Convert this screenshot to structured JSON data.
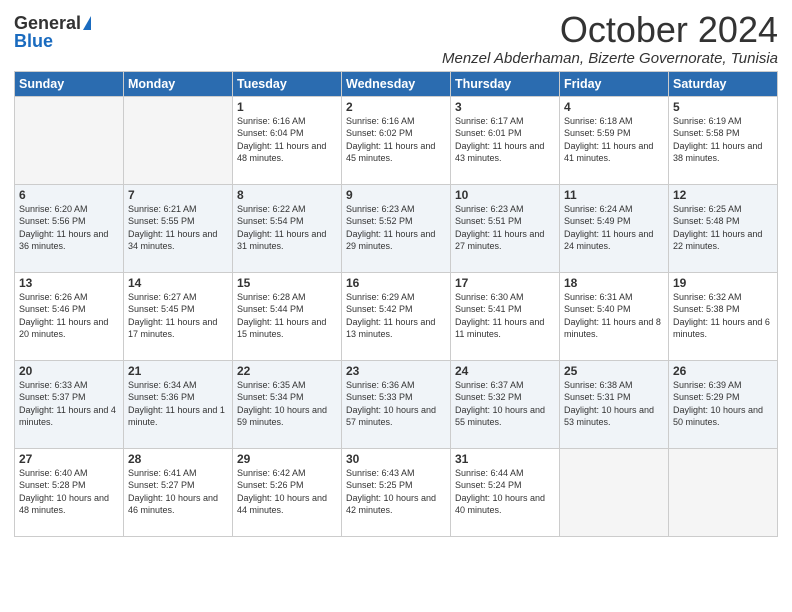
{
  "logo": {
    "general": "General",
    "blue": "Blue"
  },
  "title": "October 2024",
  "subtitle": "Menzel Abderhaman, Bizerte Governorate, Tunisia",
  "days_of_week": [
    "Sunday",
    "Monday",
    "Tuesday",
    "Wednesday",
    "Thursday",
    "Friday",
    "Saturday"
  ],
  "weeks": [
    [
      {
        "day": "",
        "sunrise": "",
        "sunset": "",
        "daylight": "",
        "empty": true
      },
      {
        "day": "",
        "sunrise": "",
        "sunset": "",
        "daylight": "",
        "empty": true
      },
      {
        "day": "1",
        "sunrise": "Sunrise: 6:16 AM",
        "sunset": "Sunset: 6:04 PM",
        "daylight": "Daylight: 11 hours and 48 minutes."
      },
      {
        "day": "2",
        "sunrise": "Sunrise: 6:16 AM",
        "sunset": "Sunset: 6:02 PM",
        "daylight": "Daylight: 11 hours and 45 minutes."
      },
      {
        "day": "3",
        "sunrise": "Sunrise: 6:17 AM",
        "sunset": "Sunset: 6:01 PM",
        "daylight": "Daylight: 11 hours and 43 minutes."
      },
      {
        "day": "4",
        "sunrise": "Sunrise: 6:18 AM",
        "sunset": "Sunset: 5:59 PM",
        "daylight": "Daylight: 11 hours and 41 minutes."
      },
      {
        "day": "5",
        "sunrise": "Sunrise: 6:19 AM",
        "sunset": "Sunset: 5:58 PM",
        "daylight": "Daylight: 11 hours and 38 minutes."
      }
    ],
    [
      {
        "day": "6",
        "sunrise": "Sunrise: 6:20 AM",
        "sunset": "Sunset: 5:56 PM",
        "daylight": "Daylight: 11 hours and 36 minutes."
      },
      {
        "day": "7",
        "sunrise": "Sunrise: 6:21 AM",
        "sunset": "Sunset: 5:55 PM",
        "daylight": "Daylight: 11 hours and 34 minutes."
      },
      {
        "day": "8",
        "sunrise": "Sunrise: 6:22 AM",
        "sunset": "Sunset: 5:54 PM",
        "daylight": "Daylight: 11 hours and 31 minutes."
      },
      {
        "day": "9",
        "sunrise": "Sunrise: 6:23 AM",
        "sunset": "Sunset: 5:52 PM",
        "daylight": "Daylight: 11 hours and 29 minutes."
      },
      {
        "day": "10",
        "sunrise": "Sunrise: 6:23 AM",
        "sunset": "Sunset: 5:51 PM",
        "daylight": "Daylight: 11 hours and 27 minutes."
      },
      {
        "day": "11",
        "sunrise": "Sunrise: 6:24 AM",
        "sunset": "Sunset: 5:49 PM",
        "daylight": "Daylight: 11 hours and 24 minutes."
      },
      {
        "day": "12",
        "sunrise": "Sunrise: 6:25 AM",
        "sunset": "Sunset: 5:48 PM",
        "daylight": "Daylight: 11 hours and 22 minutes."
      }
    ],
    [
      {
        "day": "13",
        "sunrise": "Sunrise: 6:26 AM",
        "sunset": "Sunset: 5:46 PM",
        "daylight": "Daylight: 11 hours and 20 minutes."
      },
      {
        "day": "14",
        "sunrise": "Sunrise: 6:27 AM",
        "sunset": "Sunset: 5:45 PM",
        "daylight": "Daylight: 11 hours and 17 minutes."
      },
      {
        "day": "15",
        "sunrise": "Sunrise: 6:28 AM",
        "sunset": "Sunset: 5:44 PM",
        "daylight": "Daylight: 11 hours and 15 minutes."
      },
      {
        "day": "16",
        "sunrise": "Sunrise: 6:29 AM",
        "sunset": "Sunset: 5:42 PM",
        "daylight": "Daylight: 11 hours and 13 minutes."
      },
      {
        "day": "17",
        "sunrise": "Sunrise: 6:30 AM",
        "sunset": "Sunset: 5:41 PM",
        "daylight": "Daylight: 11 hours and 11 minutes."
      },
      {
        "day": "18",
        "sunrise": "Sunrise: 6:31 AM",
        "sunset": "Sunset: 5:40 PM",
        "daylight": "Daylight: 11 hours and 8 minutes."
      },
      {
        "day": "19",
        "sunrise": "Sunrise: 6:32 AM",
        "sunset": "Sunset: 5:38 PM",
        "daylight": "Daylight: 11 hours and 6 minutes."
      }
    ],
    [
      {
        "day": "20",
        "sunrise": "Sunrise: 6:33 AM",
        "sunset": "Sunset: 5:37 PM",
        "daylight": "Daylight: 11 hours and 4 minutes."
      },
      {
        "day": "21",
        "sunrise": "Sunrise: 6:34 AM",
        "sunset": "Sunset: 5:36 PM",
        "daylight": "Daylight: 11 hours and 1 minute."
      },
      {
        "day": "22",
        "sunrise": "Sunrise: 6:35 AM",
        "sunset": "Sunset: 5:34 PM",
        "daylight": "Daylight: 10 hours and 59 minutes."
      },
      {
        "day": "23",
        "sunrise": "Sunrise: 6:36 AM",
        "sunset": "Sunset: 5:33 PM",
        "daylight": "Daylight: 10 hours and 57 minutes."
      },
      {
        "day": "24",
        "sunrise": "Sunrise: 6:37 AM",
        "sunset": "Sunset: 5:32 PM",
        "daylight": "Daylight: 10 hours and 55 minutes."
      },
      {
        "day": "25",
        "sunrise": "Sunrise: 6:38 AM",
        "sunset": "Sunset: 5:31 PM",
        "daylight": "Daylight: 10 hours and 53 minutes."
      },
      {
        "day": "26",
        "sunrise": "Sunrise: 6:39 AM",
        "sunset": "Sunset: 5:29 PM",
        "daylight": "Daylight: 10 hours and 50 minutes."
      }
    ],
    [
      {
        "day": "27",
        "sunrise": "Sunrise: 6:40 AM",
        "sunset": "Sunset: 5:28 PM",
        "daylight": "Daylight: 10 hours and 48 minutes."
      },
      {
        "day": "28",
        "sunrise": "Sunrise: 6:41 AM",
        "sunset": "Sunset: 5:27 PM",
        "daylight": "Daylight: 10 hours and 46 minutes."
      },
      {
        "day": "29",
        "sunrise": "Sunrise: 6:42 AM",
        "sunset": "Sunset: 5:26 PM",
        "daylight": "Daylight: 10 hours and 44 minutes."
      },
      {
        "day": "30",
        "sunrise": "Sunrise: 6:43 AM",
        "sunset": "Sunset: 5:25 PM",
        "daylight": "Daylight: 10 hours and 42 minutes."
      },
      {
        "day": "31",
        "sunrise": "Sunrise: 6:44 AM",
        "sunset": "Sunset: 5:24 PM",
        "daylight": "Daylight: 10 hours and 40 minutes."
      },
      {
        "day": "",
        "sunrise": "",
        "sunset": "",
        "daylight": "",
        "empty": true
      },
      {
        "day": "",
        "sunrise": "",
        "sunset": "",
        "daylight": "",
        "empty": true
      }
    ]
  ],
  "colors": {
    "header_bg": "#2b6cb0",
    "header_text": "#ffffff",
    "row_shade": "#f0f4f8",
    "logo_blue": "#1a6bbf"
  }
}
